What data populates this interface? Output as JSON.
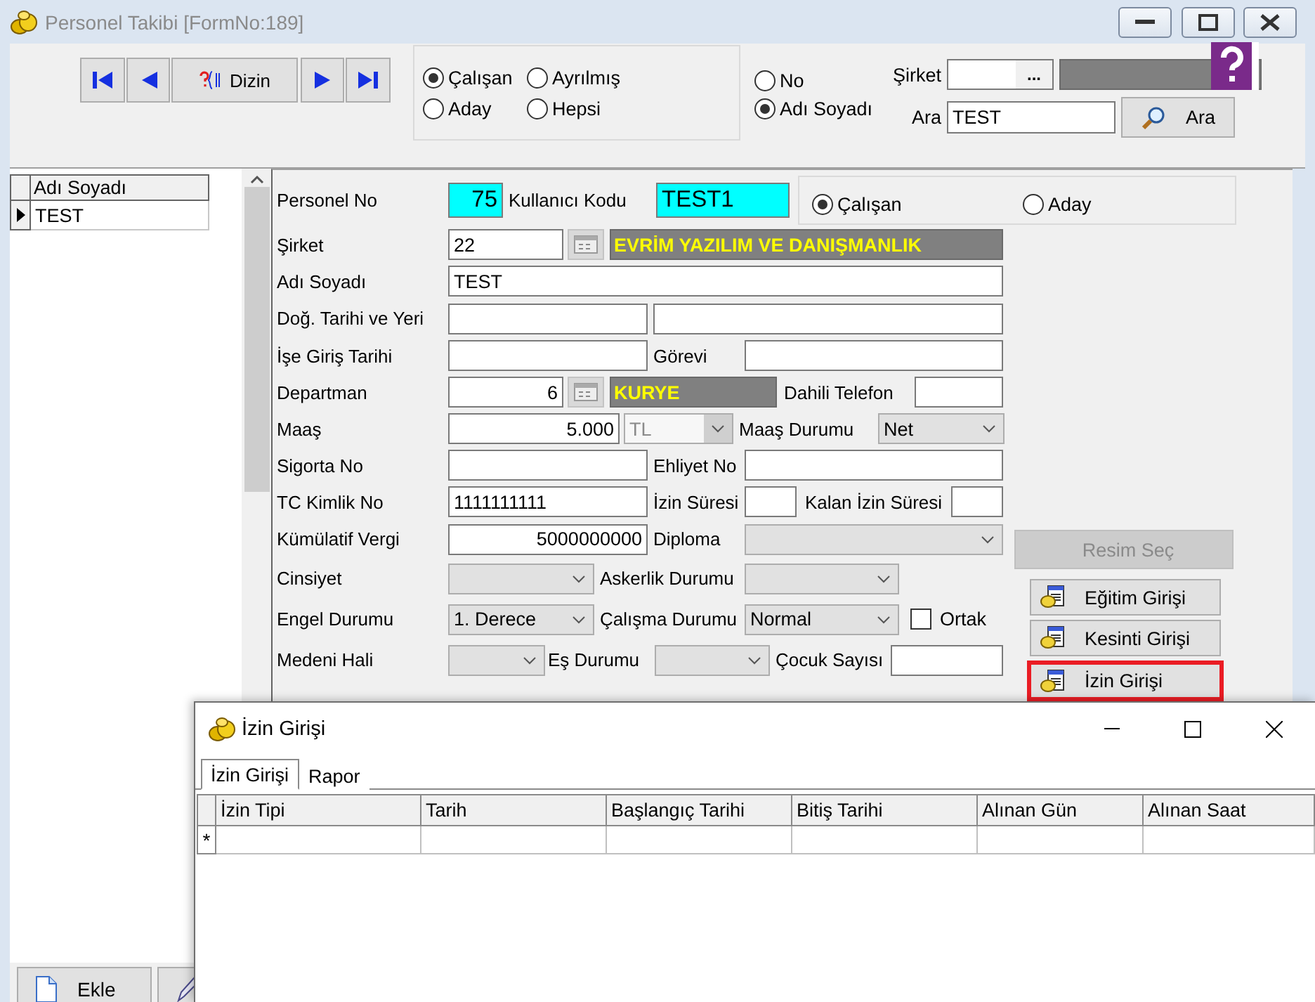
{
  "window": {
    "title": "Personel Takibi [FormNo:189]"
  },
  "navigator": {
    "buttons": [
      {
        "kind": "first"
      },
      {
        "kind": "prev"
      },
      {
        "kind": "index",
        "label": "Dizin"
      },
      {
        "kind": "next"
      },
      {
        "kind": "last"
      }
    ]
  },
  "status_filter": [
    {
      "label": "Çalışan",
      "selected": true
    },
    {
      "label": "Ayrılmış",
      "selected": false
    },
    {
      "label": "Aday",
      "selected": false
    },
    {
      "label": "Hepsi",
      "selected": false
    }
  ],
  "search_by": [
    {
      "label": "No",
      "selected": false
    },
    {
      "label": "Adı Soyadı",
      "selected": true
    }
  ],
  "company_filter": {
    "label": "Şirket",
    "button": "..."
  },
  "search": {
    "label": "Ara",
    "value": "TEST",
    "button": "Ara"
  },
  "list": {
    "columns": [
      "Adı Soyadı"
    ],
    "rows": [
      {
        "cells": [
          "TEST"
        ],
        "selected": true
      }
    ]
  },
  "form": {
    "rows": [
      {
        "items": [
          {
            "kind": "label",
            "text": "Personel No"
          },
          {
            "kind": "highlight",
            "value": "75"
          },
          {
            "kind": "label",
            "text": "Kullanıcı Kodu"
          },
          {
            "kind": "highlight",
            "value": "TEST1"
          },
          {
            "kind": "radio_group",
            "options": [
              {
                "label": "Çalışan",
                "selected": true
              },
              {
                "label": "Aday",
                "selected": false
              }
            ]
          }
        ]
      },
      {
        "items": [
          {
            "kind": "label",
            "text": "Şirket"
          },
          {
            "kind": "input",
            "value": "22"
          },
          {
            "kind": "lookup"
          },
          {
            "kind": "display",
            "text": "EVRİM YAZILIM VE DANIŞMANLIK"
          }
        ]
      },
      {
        "items": [
          {
            "kind": "label",
            "text": "Adı Soyadı"
          },
          {
            "kind": "input",
            "value": "TEST"
          }
        ]
      },
      {
        "items": [
          {
            "kind": "label",
            "text": "Doğ. Tarihi ve Yeri"
          },
          {
            "kind": "input"
          },
          {
            "kind": "input"
          }
        ]
      },
      {
        "items": [
          {
            "kind": "label",
            "text": "İşe Giriş Tarihi"
          },
          {
            "kind": "input"
          },
          {
            "kind": "label",
            "text": "Görevi"
          },
          {
            "kind": "input"
          }
        ]
      },
      {
        "items": [
          {
            "kind": "label",
            "text": "Departman"
          },
          {
            "kind": "input",
            "value": "6"
          },
          {
            "kind": "lookup"
          },
          {
            "kind": "display",
            "text": "KURYE"
          },
          {
            "kind": "label",
            "text": "Dahili Telefon"
          },
          {
            "kind": "input"
          }
        ]
      },
      {
        "items": [
          {
            "kind": "label",
            "text": "Maaş"
          },
          {
            "kind": "input",
            "value": "5.000"
          },
          {
            "kind": "combo",
            "value": "TL",
            "disabled": true
          },
          {
            "kind": "label",
            "text": "Maaş Durumu"
          },
          {
            "kind": "combo",
            "value": "Net",
            "disabled": false
          }
        ]
      },
      {
        "items": [
          {
            "kind": "label",
            "text": "Sigorta No"
          },
          {
            "kind": "input"
          },
          {
            "kind": "label",
            "text": "Ehliyet No"
          },
          {
            "kind": "input"
          }
        ]
      },
      {
        "items": [
          {
            "kind": "label",
            "text": "TC Kimlik No"
          },
          {
            "kind": "input",
            "value": "1111111111"
          },
          {
            "kind": "label",
            "text": "İzin Süresi"
          },
          {
            "kind": "input"
          },
          {
            "kind": "label",
            "text": "Kalan İzin Süresi"
          },
          {
            "kind": "input"
          }
        ]
      },
      {
        "items": [
          {
            "kind": "label",
            "text": "Kümülatif Vergi"
          },
          {
            "kind": "input",
            "value": "5000000000"
          },
          {
            "kind": "label",
            "text": "Diploma"
          },
          {
            "kind": "combo",
            "disabled": false
          }
        ]
      },
      {
        "items": [
          {
            "kind": "label",
            "text": "Cinsiyet"
          },
          {
            "kind": "combo",
            "disabled": false
          },
          {
            "kind": "label",
            "text": "Askerlik Durumu"
          },
          {
            "kind": "combo",
            "disabled": false
          }
        ]
      },
      {
        "items": [
          {
            "kind": "label",
            "text": "Engel Durumu"
          },
          {
            "kind": "combo",
            "value": "1. Derece",
            "disabled": false
          },
          {
            "kind": "label",
            "text": "Çalışma Durumu"
          },
          {
            "kind": "combo",
            "value": "Normal",
            "disabled": false
          },
          {
            "kind": "checkbox",
            "label": "Ortak",
            "checked": false
          }
        ]
      },
      {
        "items": [
          {
            "kind": "label",
            "text": "Medeni Hali"
          },
          {
            "kind": "combo",
            "disabled": false
          },
          {
            "kind": "label",
            "text": "Eş Durumu"
          },
          {
            "kind": "combo",
            "disabled": false
          },
          {
            "kind": "label",
            "text": "Çocuk Sayısı"
          },
          {
            "kind": "input"
          }
        ]
      }
    ]
  },
  "actions": [
    {
      "kind": "plain",
      "label": "Resim Seç",
      "disabled": true,
      "highlighted": false
    },
    {
      "kind": "document",
      "label": "Eğitim Girişi",
      "disabled": false,
      "highlighted": false
    },
    {
      "kind": "document",
      "label": "Kesinti Girişi",
      "disabled": false,
      "highlighted": false
    },
    {
      "kind": "document",
      "label": "İzin Girişi",
      "disabled": false,
      "highlighted": true
    }
  ],
  "toolbar": [
    {
      "kind": "new",
      "label": "Ekle"
    },
    {
      "kind": "edit"
    }
  ],
  "dialog": {
    "title": "İzin Girişi",
    "tabs": [
      {
        "label": "İzin Girişi",
        "selected": true
      },
      {
        "label": "Rapor",
        "selected": false
      }
    ],
    "table": {
      "columns": [
        "İzin Tipi",
        "Tarih",
        "Başlangıç Tarihi",
        "Bitiş Tarihi",
        "Alınan Gün",
        "Alınan Saat"
      ],
      "rows": [
        {
          "marker": "*"
        }
      ]
    }
  }
}
